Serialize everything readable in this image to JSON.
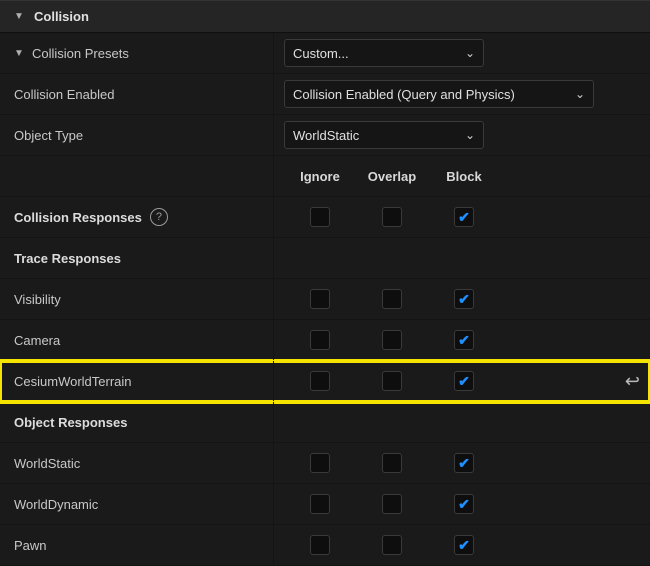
{
  "section": {
    "title": "Collision"
  },
  "presets": {
    "label": "Collision Presets",
    "value": "Custom..."
  },
  "collisionEnabled": {
    "label": "Collision Enabled",
    "value": "Collision Enabled (Query and Physics)"
  },
  "objectType": {
    "label": "Object Type",
    "value": "WorldStatic"
  },
  "columns": {
    "c1": "Ignore",
    "c2": "Overlap",
    "c3": "Block"
  },
  "responses": {
    "label": "Collision Responses"
  },
  "traceHeader": "Trace Responses",
  "trace": [
    {
      "label": "Visibility",
      "ignore": false,
      "overlap": false,
      "block": true,
      "hl": false
    },
    {
      "label": "Camera",
      "ignore": false,
      "overlap": false,
      "block": true,
      "hl": false
    },
    {
      "label": "CesiumWorldTerrain",
      "ignore": false,
      "overlap": false,
      "block": true,
      "hl": true
    }
  ],
  "objectHeader": "Object Responses",
  "objects": [
    {
      "label": "WorldStatic",
      "ignore": false,
      "overlap": false,
      "block": true
    },
    {
      "label": "WorldDynamic",
      "ignore": false,
      "overlap": false,
      "block": true
    },
    {
      "label": "Pawn",
      "ignore": false,
      "overlap": false,
      "block": true
    }
  ]
}
